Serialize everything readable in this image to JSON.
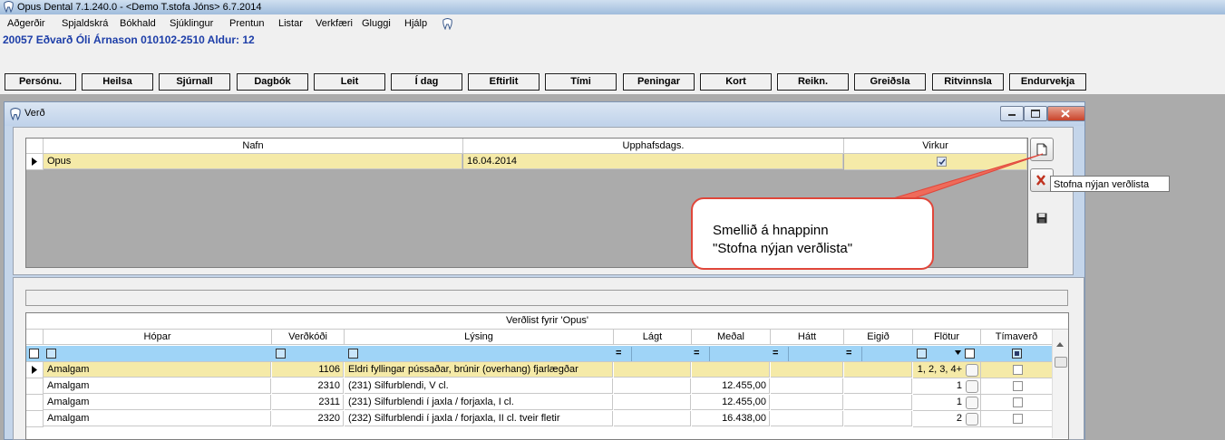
{
  "app": {
    "title": "Opus Dental 7.1.240.0 - <Demo T.stofa Jóns> 6.7.2014"
  },
  "menu": [
    "Aðgerðir",
    "Spjaldskrá",
    "Bókhald",
    "Sjúklingur",
    "Prentun",
    "Listar",
    "Verkfæri",
    "Gluggi",
    "Hjálp"
  ],
  "patient": {
    "banner": "20057 Eðvarð Óli Árnason 010102-2510  Aldur: 12"
  },
  "nav_buttons": [
    "Persónu.",
    "Heilsa",
    "Sjúrnall",
    "Dagbók",
    "Leit",
    "Í dag",
    "Eftirlit",
    "Tími",
    "Peningar",
    "Kort",
    "Reikn.",
    "Greiðsla",
    "Ritvinnsla",
    "Endurvekja"
  ],
  "window": {
    "title": "Verð"
  },
  "pricelists": {
    "columns": [
      "Nafn",
      "Upphafsdags.",
      "Virkur"
    ],
    "rows": [
      {
        "name": "Opus",
        "start_date": "16.04.2014",
        "active": true
      }
    ]
  },
  "side_buttons": {
    "new_tooltip": "Stofna nýjan verðlista"
  },
  "callout": {
    "line1": "Smellið á hnappinn",
    "line2": "\"Stofna nýjan verðlista\""
  },
  "prices": {
    "caption": "Verðlist fyrir 'Opus'",
    "columns": [
      "Hópar",
      "Verðkóði",
      "Lýsing",
      "Lágt",
      "Meðal",
      "Hátt",
      "Eigið",
      "Flötur",
      "Tímaverð"
    ],
    "filter_ops": [
      "=",
      "=",
      "=",
      "="
    ],
    "rows": [
      {
        "group": "Amalgam",
        "code": "1106",
        "desc": "Eldri fyllingar pússaðar, brúnir (overhang) fjarlægðar",
        "low": "",
        "mid": "",
        "high": "",
        "own": "",
        "surface": "1, 2, 3, 4+",
        "timed": false
      },
      {
        "group": "Amalgam",
        "code": "2310",
        "desc": "(231) Silfurblendi, V cl.",
        "low": "",
        "mid": "12.455,00",
        "high": "",
        "own": "",
        "surface": "1",
        "timed": false
      },
      {
        "group": "Amalgam",
        "code": "2311",
        "desc": "(231) Silfurblendi í jaxla / forjaxla, I cl.",
        "low": "",
        "mid": "12.455,00",
        "high": "",
        "own": "",
        "surface": "1",
        "timed": false
      },
      {
        "group": "Amalgam",
        "code": "2320",
        "desc": "(232) Silfurblendi í jaxla / forjaxla, II cl. tveir fletir",
        "low": "",
        "mid": "16.438,00",
        "high": "",
        "own": "",
        "surface": "2",
        "timed": false
      }
    ]
  },
  "colors": {
    "selected_row": "#f5eaa8",
    "filter_row": "#9fd4f7",
    "patient_text": "#1d3ea8",
    "callout_border": "#e0463a"
  }
}
